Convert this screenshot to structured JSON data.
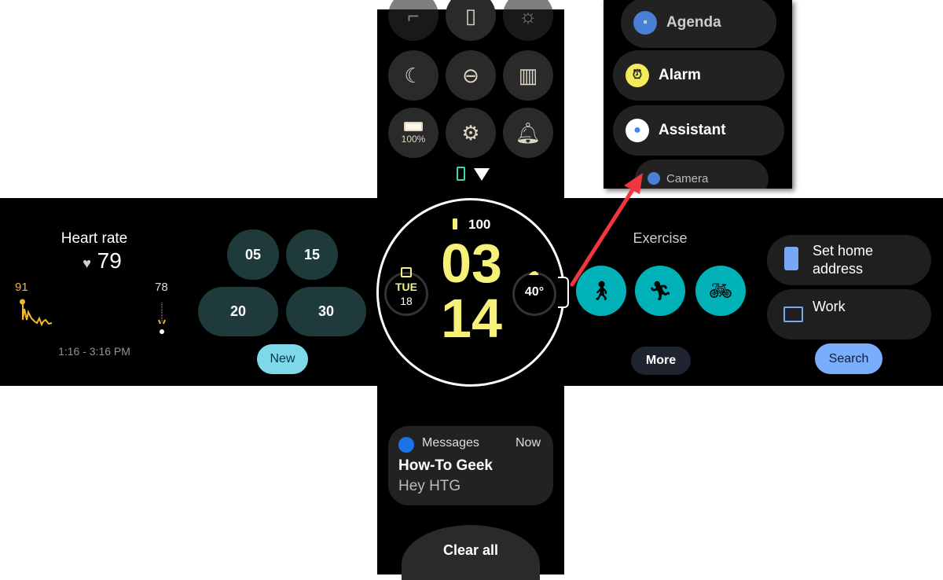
{
  "heart_rate": {
    "title": "Heart rate",
    "value": "79",
    "max": "91",
    "current": "78",
    "range": "1:16 - 3:16 PM",
    "accent": "#f3b72b"
  },
  "timer": {
    "options": [
      "05",
      "15",
      "20",
      "30"
    ],
    "new_label": "New"
  },
  "quick_settings": {
    "battery_label": "100%",
    "icons": [
      "flashlight-icon",
      "phone-icon",
      "brightness-icon",
      "bedtime-icon",
      "do-not-disturb-icon",
      "theater-mode-icon",
      "battery-icon",
      "settings-icon",
      "bell-icon"
    ]
  },
  "watch_face": {
    "battery": "100",
    "hour": "03",
    "minute": "14",
    "day": "TUE",
    "date": "18",
    "temperature": "40°",
    "accent": "#f7f17a"
  },
  "exercise": {
    "title": "Exercise",
    "activities": [
      "walk-icon",
      "run-icon",
      "bike-icon"
    ],
    "more_label": "More"
  },
  "maps": {
    "items": [
      {
        "label": "Set home address",
        "icon": "phone-login-icon"
      },
      {
        "label": "Work",
        "icon": "briefcase-icon"
      }
    ],
    "search_label": "Search"
  },
  "notification": {
    "app": "Messages",
    "time": "Now",
    "title": "How-To Geek",
    "body": "Hey HTG",
    "clear_label": "Clear all"
  },
  "apps": {
    "items": [
      "Agenda",
      "Alarm",
      "Assistant",
      "Camera"
    ]
  },
  "annotation": {
    "arrow_color": "#f0363f"
  }
}
